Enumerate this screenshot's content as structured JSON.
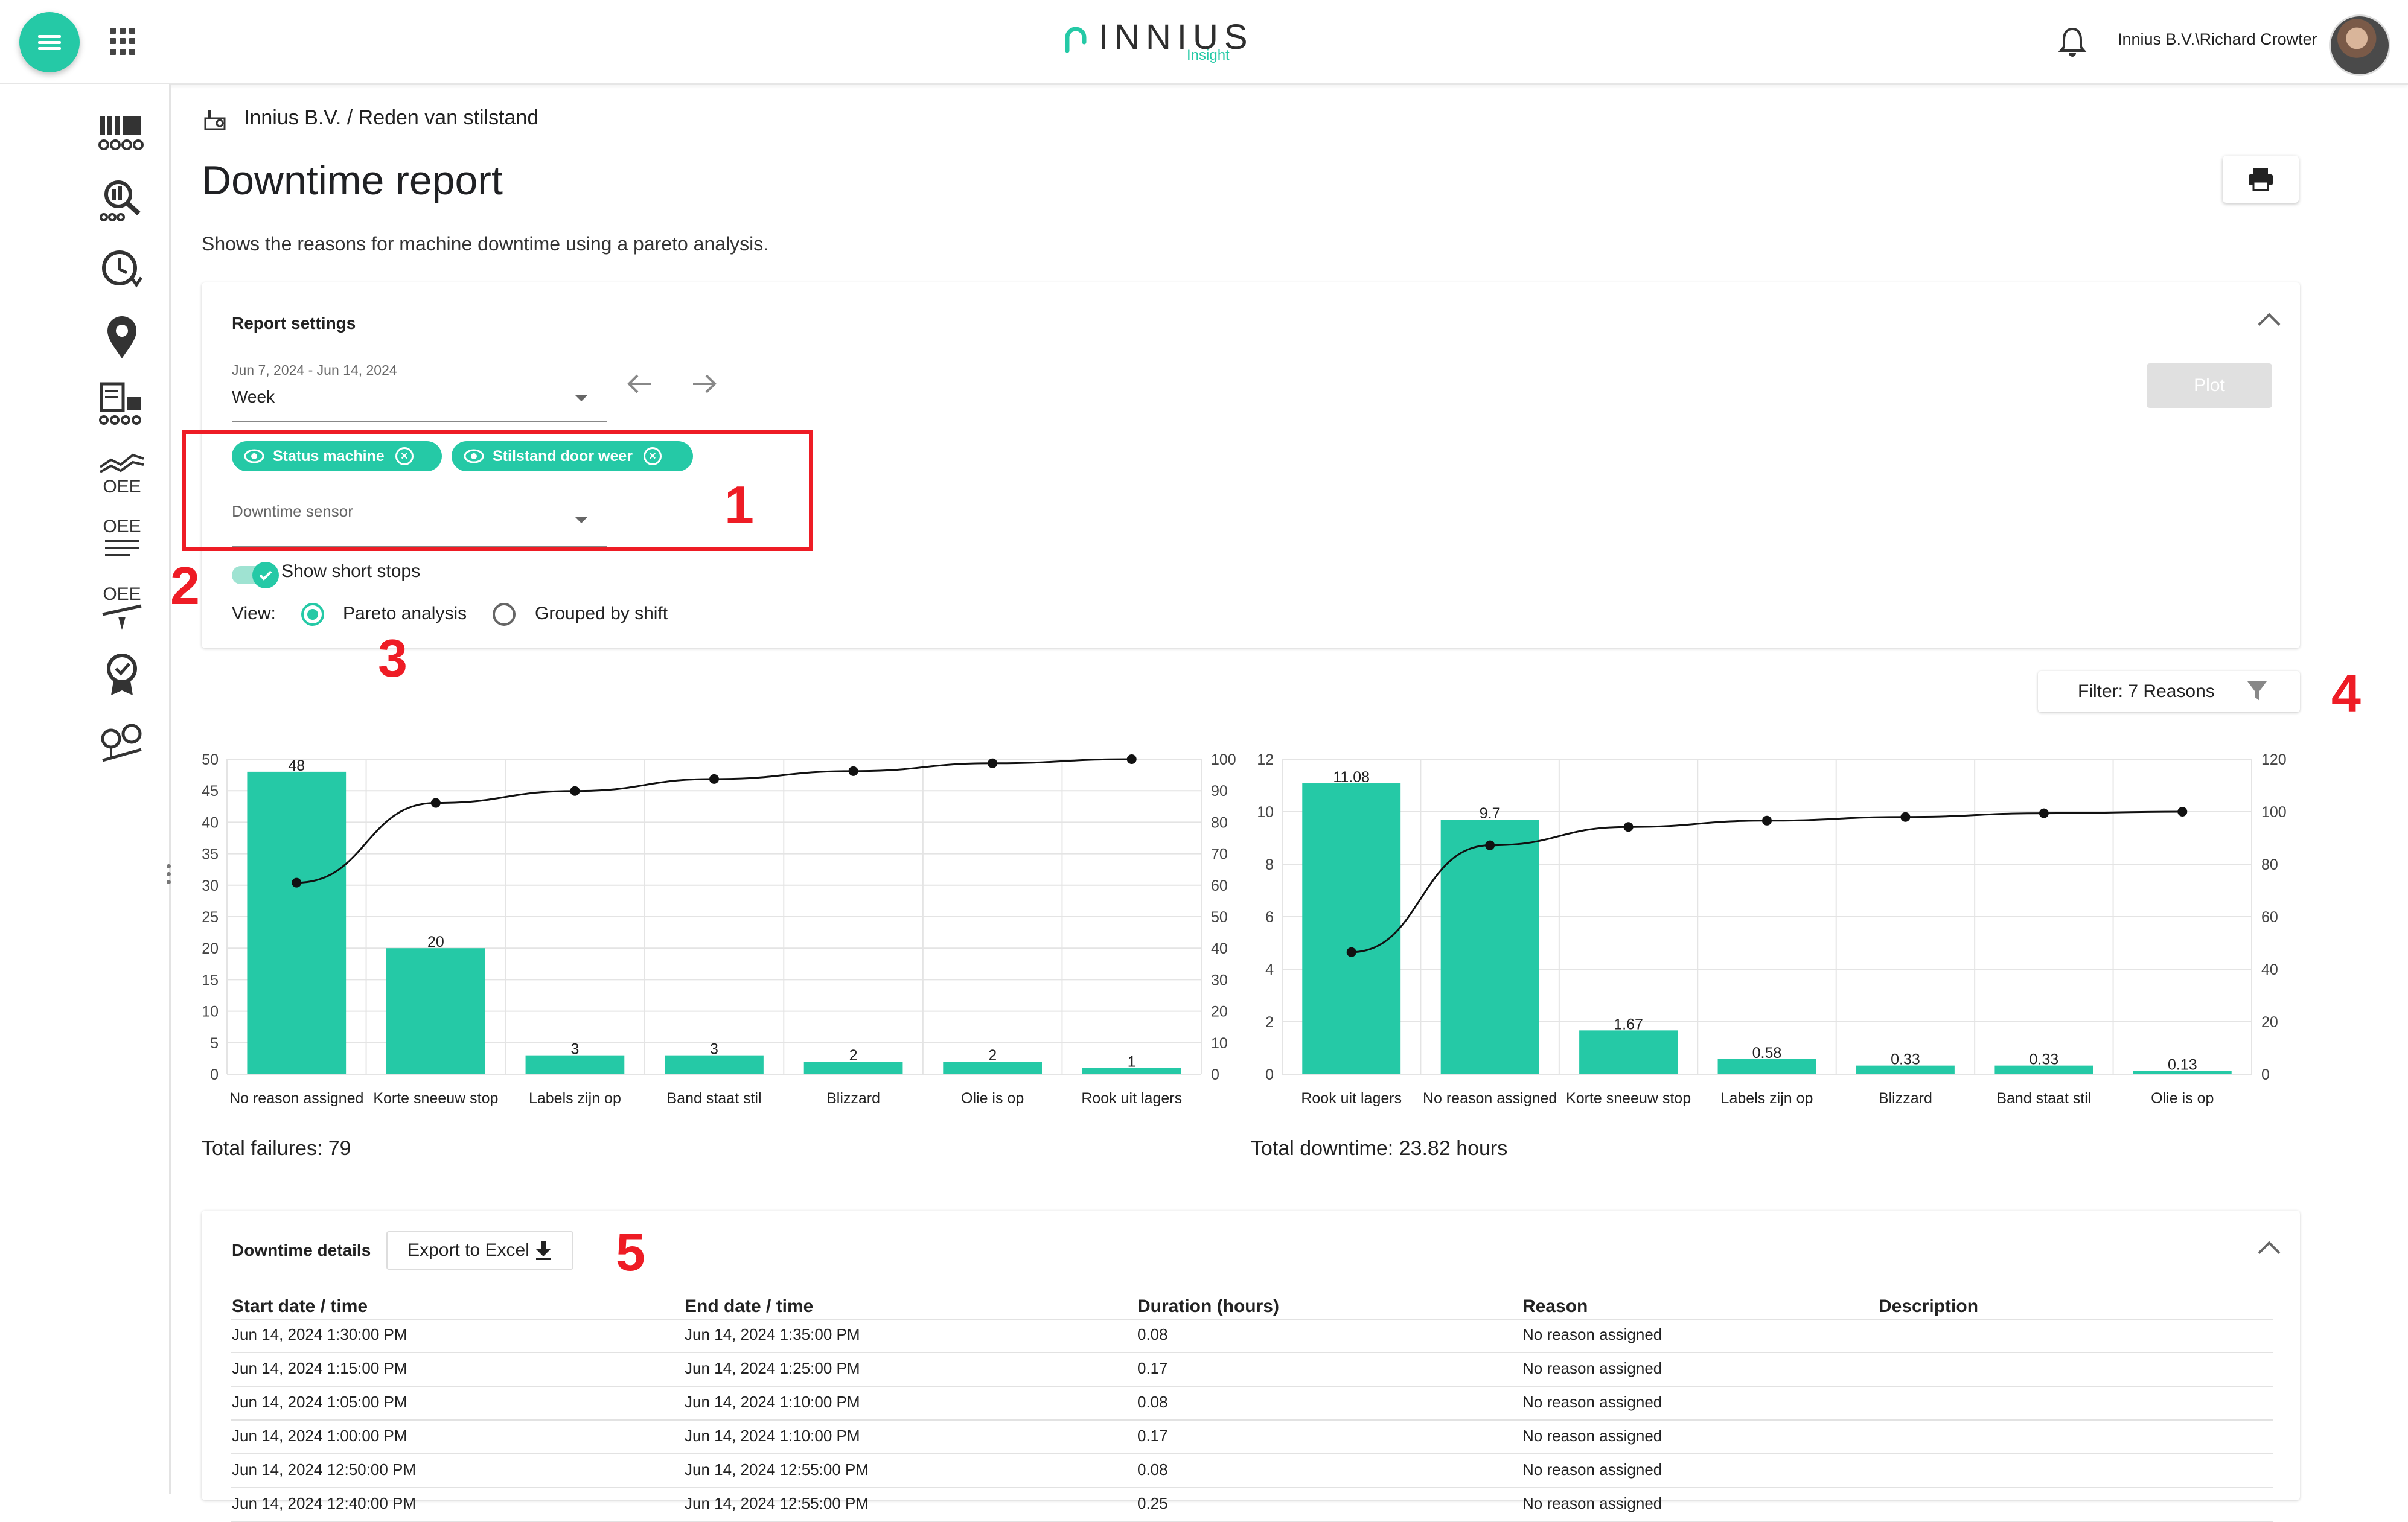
{
  "topbar": {
    "logo_text": "INNIUS",
    "logo_sub": "Insight",
    "user_name": "Innius B.V.\\Richard Crowter"
  },
  "sidebar": {
    "icons": [
      "production-icon",
      "search-analysis-icon",
      "clock-icon",
      "location-icon",
      "report-icon",
      "oee-trend-icon",
      "oee-list-icon",
      "oee-scale-icon",
      "quality-icon",
      "maintenance-icon"
    ]
  },
  "breadcrumb": "Innius B.V. / Reden van stilstand",
  "page": {
    "title": "Downtime report",
    "subtitle": "Shows the reasons for machine downtime using a pareto analysis."
  },
  "settings": {
    "header": "Report settings",
    "date_range": "Jun 7, 2024 - Jun 14, 2024",
    "period": "Week",
    "chips": [
      "Status machine",
      "Stilstand door weer"
    ],
    "sensor_placeholder": "Downtime sensor",
    "show_short_stops": "Show short stops",
    "view_label": "View:",
    "view_options": [
      "Pareto analysis",
      "Grouped by shift"
    ],
    "plot_label": "Plot"
  },
  "annotations": [
    "1",
    "2",
    "3",
    "4",
    "5"
  ],
  "filter_label": "Filter: 7 Reasons",
  "colors": {
    "accent": "#25c9a6",
    "annotation_red": "#ee1c25"
  },
  "chart_data": [
    {
      "type": "bar",
      "categories": [
        "No reason assigned",
        "Korte sneeuw stop",
        "Labels zijn op",
        "Band staat stil",
        "Blizzard",
        "Olie is op",
        "Rook uit lagers"
      ],
      "values": [
        48,
        20,
        3,
        3,
        2,
        2,
        1
      ],
      "cumulative_percent": [
        60.8,
        86.1,
        89.9,
        93.7,
        96.2,
        98.7,
        100
      ],
      "ylim": [
        0,
        50
      ],
      "y2lim": [
        0,
        100
      ],
      "yticks": [
        "0",
        "5",
        "10",
        "15",
        "20",
        "25",
        "30",
        "35",
        "40",
        "45",
        "50"
      ],
      "y2ticks": [
        "0",
        "10",
        "20",
        "30",
        "40",
        "50",
        "60",
        "70",
        "80",
        "90",
        "100"
      ],
      "value_labels": [
        "48",
        "20",
        "3",
        "3",
        "2",
        "2",
        "1"
      ],
      "grid": true
    },
    {
      "type": "bar",
      "categories": [
        "Rook uit lagers",
        "No reason assigned",
        "Korte sneeuw stop",
        "Labels zijn op",
        "Blizzard",
        "Band staat stil",
        "Olie is op"
      ],
      "values": [
        11.08,
        9.7,
        1.67,
        0.58,
        0.33,
        0.33,
        0.13
      ],
      "cumulative_percent": [
        46.5,
        87.2,
        94.2,
        96.6,
        98.0,
        99.4,
        100
      ],
      "ylim": [
        0,
        12
      ],
      "y2lim": [
        0,
        120
      ],
      "yticks": [
        "0",
        "2",
        "4",
        "6",
        "8",
        "10",
        "12"
      ],
      "y2ticks": [
        "0",
        "20",
        "40",
        "60",
        "80",
        "100",
        "120"
      ],
      "value_labels": [
        "11.08",
        "9.7",
        "1.67",
        "0.58",
        "0.33",
        "0.33",
        "0.13"
      ],
      "grid": true
    }
  ],
  "totals": {
    "failures": "Total failures: 79",
    "downtime": "Total downtime: 23.82 hours"
  },
  "details": {
    "header": "Downtime details",
    "export_label": "Export to Excel",
    "columns": [
      "Start date / time",
      "End date / time",
      "Duration (hours)",
      "Reason",
      "Description"
    ],
    "rows": [
      [
        "Jun 14, 2024 1:30:00 PM",
        "Jun 14, 2024 1:35:00 PM",
        "0.08",
        "No reason assigned",
        ""
      ],
      [
        "Jun 14, 2024 1:15:00 PM",
        "Jun 14, 2024 1:25:00 PM",
        "0.17",
        "No reason assigned",
        ""
      ],
      [
        "Jun 14, 2024 1:05:00 PM",
        "Jun 14, 2024 1:10:00 PM",
        "0.08",
        "No reason assigned",
        ""
      ],
      [
        "Jun 14, 2024 1:00:00 PM",
        "Jun 14, 2024 1:10:00 PM",
        "0.17",
        "No reason assigned",
        ""
      ],
      [
        "Jun 14, 2024 12:50:00 PM",
        "Jun 14, 2024 12:55:00 PM",
        "0.08",
        "No reason assigned",
        ""
      ],
      [
        "Jun 14, 2024 12:40:00 PM",
        "Jun 14, 2024 12:55:00 PM",
        "0.25",
        "No reason assigned",
        ""
      ]
    ]
  }
}
